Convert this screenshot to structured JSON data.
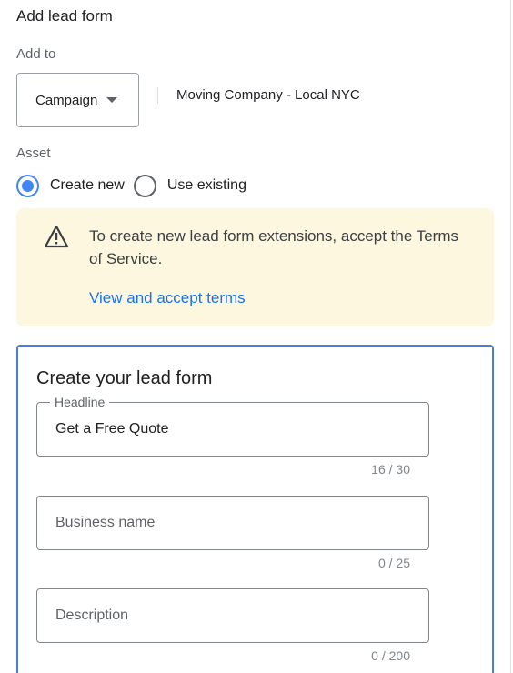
{
  "header": {
    "title": "Add lead form"
  },
  "add_to": {
    "label": "Add to",
    "dropdown_value": "Campaign",
    "campaign_name": "Moving Company - Local NYC"
  },
  "asset": {
    "label": "Asset",
    "options": [
      {
        "label": "Create new",
        "selected": true
      },
      {
        "label": "Use existing",
        "selected": false
      }
    ]
  },
  "notice": {
    "text": "To create new lead form extensions, accept the Terms of Service.",
    "link": "View and accept terms",
    "icon": "warning-icon"
  },
  "form": {
    "title": "Create your lead form",
    "fields": [
      {
        "label": "Headline",
        "value": "Get a Free Quote",
        "counter": "16 / 30"
      },
      {
        "placeholder": "Business name",
        "value": "",
        "counter": "0 / 25"
      },
      {
        "placeholder": "Description",
        "value": "",
        "counter": "0 / 200"
      }
    ]
  },
  "colors": {
    "accent": "#4285f4",
    "link": "#1a73e8",
    "notice_bg": "#fef7e0",
    "warning_icon": "#8a5a00"
  }
}
